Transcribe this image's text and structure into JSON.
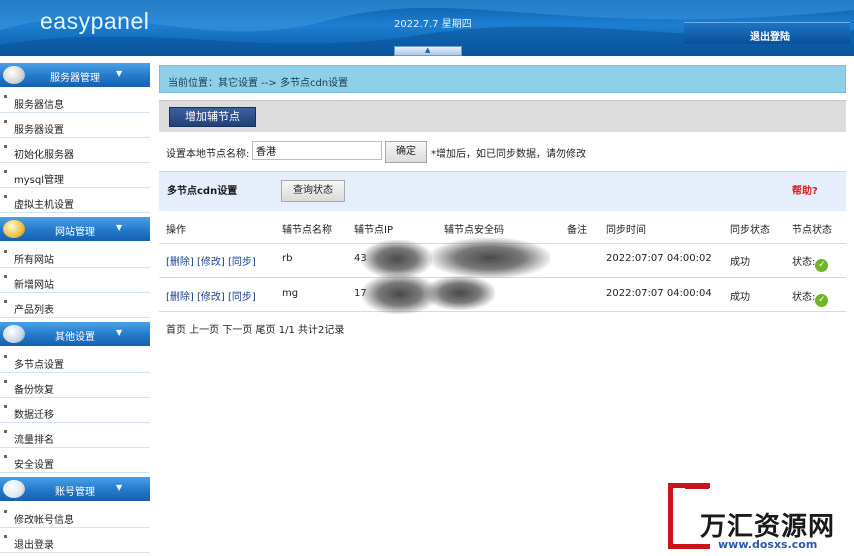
{
  "header": {
    "logo": "easypanel",
    "date": "2022.7.7 星期四",
    "logout": "退出登陆",
    "toggle_arrow": "▲"
  },
  "sidebar": {
    "groups": [
      {
        "title": "服务器管理",
        "items": [
          "服务器信息",
          "服务器设置",
          "初始化服务器",
          "mysql管理",
          "虚拟主机设置"
        ]
      },
      {
        "title": "网站管理",
        "items": [
          "所有网站",
          "新增网站",
          "产品列表"
        ]
      },
      {
        "title": "其他设置",
        "items": [
          "多节点设置",
          "备份恢复",
          "数据迁移",
          "流量排名",
          "安全设置"
        ]
      },
      {
        "title": "账号管理",
        "items": [
          "修改帐号信息",
          "退出登录"
        ]
      }
    ],
    "arrow": "▼"
  },
  "breadcrumb": "当前位置：其它设置 --> 多节点cdn设置",
  "toolbar": {
    "add_node": "增加辅节点"
  },
  "local_node": {
    "label": "设置本地节点名称:",
    "value": "香港",
    "confirm": "确定",
    "note": "*增加后，如已同步数据，请勿修改"
  },
  "cdn": {
    "title": "多节点cdn设置",
    "query_status": "查询状态",
    "help": "帮助?"
  },
  "table": {
    "headers": [
      "操作",
      "辅节点名称",
      "辅节点IP",
      "辅节点安全码",
      "备注",
      "同步时间",
      "同步状态",
      "节点状态"
    ],
    "rows": [
      {
        "actions": [
          "[删除]",
          "[修改]",
          "[同步]"
        ],
        "name": "rb",
        "ip": "43",
        "code": "",
        "remark": "",
        "sync_time": "2022:07:07 04:00:02",
        "sync_status": "成功",
        "node_status": "状态:"
      },
      {
        "actions": [
          "[删除]",
          "[修改]",
          "[同步]"
        ],
        "name": "mg",
        "ip": "17",
        "code": "",
        "remark": "",
        "sync_time": "2022:07:07 04:00:04",
        "sync_status": "成功",
        "node_status": "状态:"
      }
    ]
  },
  "pager": "首页 上一页 下一页 尾页 1/1  共计2记录",
  "watermark": {
    "text": "万汇资源网",
    "url": "www.dosxs.com"
  },
  "colors": {
    "header": "#1d7fd1",
    "breadcrumb": "#8ed0ea",
    "help": "#d42020",
    "ok": "#6fb52c"
  }
}
